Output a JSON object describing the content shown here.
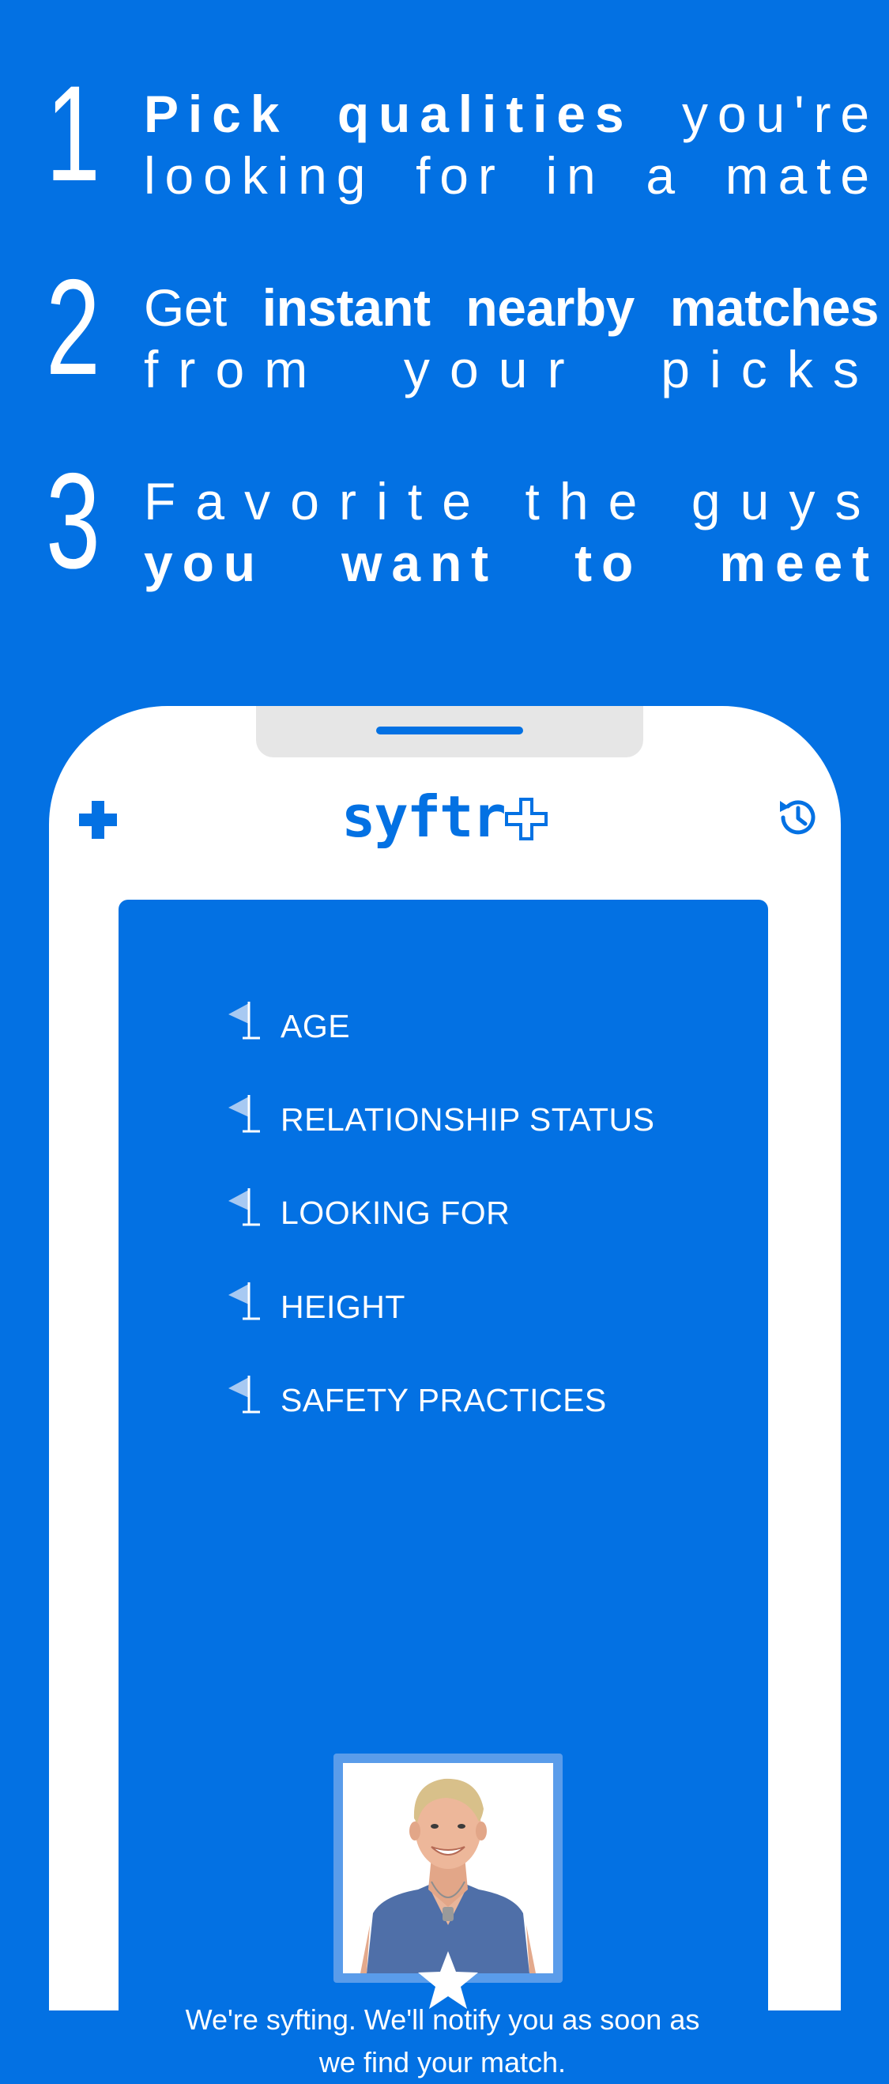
{
  "steps": [
    {
      "number": "1",
      "line1_bold": "Pick qualities",
      "line1_rest": " you're",
      "line2": "looking for in a mate"
    },
    {
      "number": "2",
      "line1_lead": "Get ",
      "line1_bold": "instant nearby matches",
      "line2": "from your picks"
    },
    {
      "number": "3",
      "line1": "Favorite the guys",
      "line2_bold": "you want to meet"
    }
  ],
  "app": {
    "logo_text": "syftr",
    "brand_color": "#0371E3",
    "icons": {
      "left": "plus-icon",
      "right": "history-icon"
    }
  },
  "criteria": [
    {
      "label": "AGE",
      "icon": "flag-icon"
    },
    {
      "label": "RELATIONSHIP STATUS",
      "icon": "flag-icon"
    },
    {
      "label": "LOOKING FOR",
      "icon": "flag-icon"
    },
    {
      "label": "HEIGHT",
      "icon": "flag-icon"
    },
    {
      "label": "SAFETY PRACTICES",
      "icon": "flag-icon"
    }
  ],
  "match": {
    "photo": "profile-photo",
    "badge_icon": "star-icon",
    "message": "We're syfting. We'll notify you as soon as we find your match."
  }
}
